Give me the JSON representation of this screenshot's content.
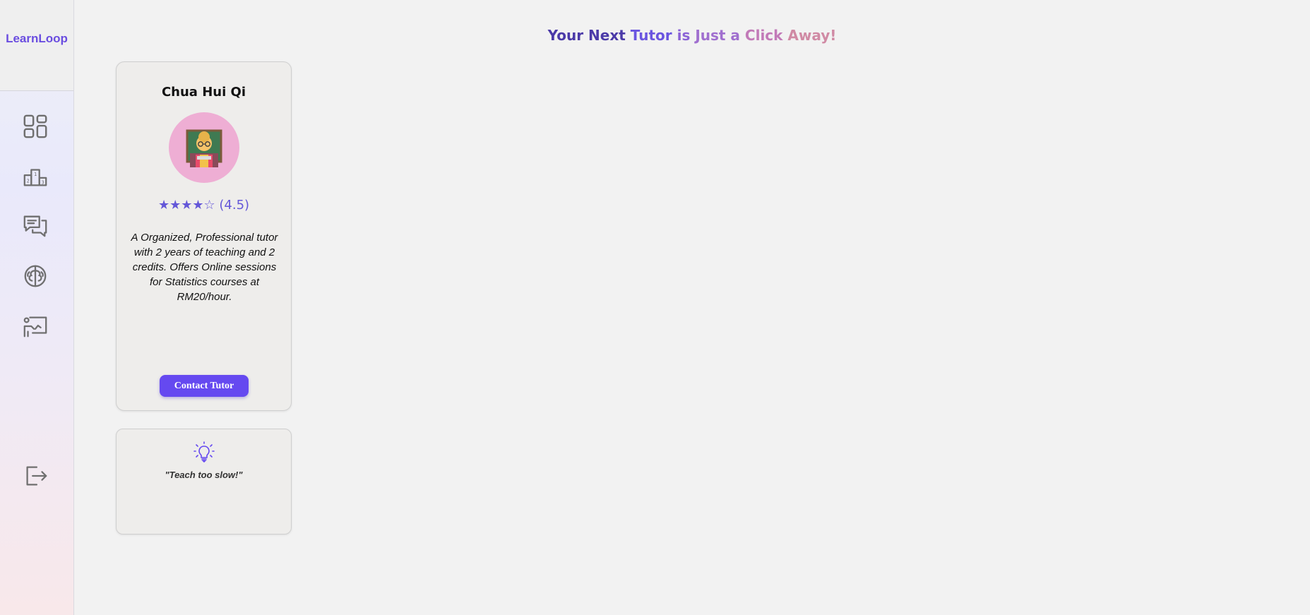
{
  "sidebar": {
    "brand": "LearnLoop",
    "items": [
      {
        "icon": "dashboard-icon"
      },
      {
        "icon": "leaderboard-icon"
      },
      {
        "icon": "chat-icon"
      },
      {
        "icon": "brain-icon"
      },
      {
        "icon": "tutor-board-icon"
      }
    ],
    "logout_icon": "logout-icon"
  },
  "headline": {
    "parts": [
      "Your Next",
      "Tutor",
      "is",
      "Just a",
      "Click",
      "Away!"
    ]
  },
  "tutor_card": {
    "name": "Chua Hui Qi",
    "avatar_icon": "teacher-emoji",
    "stars": "★★★★☆",
    "rating": "(4.5)",
    "description": "A Organized, Professional tutor with 2 years of teaching and 2 credits. Offers Online sessions for Statistics courses at RM20/hour.",
    "contact_label": "Contact Tutor"
  },
  "tip_card": {
    "icon": "lightbulb-icon",
    "text": "\"Teach too slow!\""
  },
  "colors": {
    "accent": "#6549f0",
    "brand": "#6a4de0",
    "avatar_bg": "#eeaed4"
  }
}
